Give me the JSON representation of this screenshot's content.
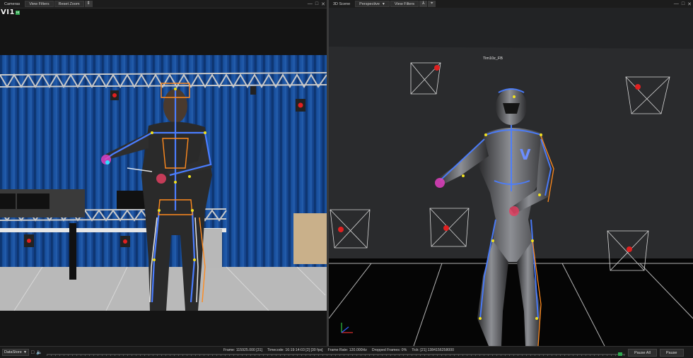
{
  "left_toolbar": {
    "cameras_label": "Cameras",
    "view_filters_label": "View Filters",
    "reset_zoom_label": "Reset Zoom",
    "extra_icon": "expand-icon"
  },
  "right_toolbar": {
    "scene_label": "3D Scene",
    "perspective_label": "Perspective",
    "view_filters_label": "View Filters",
    "icons": [
      "axis-icon",
      "camera-view-icon"
    ]
  },
  "window_controls": {
    "minimize": "—",
    "maximize": "□",
    "close": "✕"
  },
  "left_overlay": {
    "logo_text": "VI1",
    "logo_badge": "HI"
  },
  "right_overlay": {
    "subject_name": "Tim10z_FB"
  },
  "statusbar": {
    "data_store": "DataStore",
    "frame": "Frame: 115925.000 [31]",
    "timecode": "Timecode: 16:19:14:03 [2] [30 fps]",
    "frame_rate": "Frame Rate: 120.000Hz",
    "dropped_frames": "Dropped Frames: 0%",
    "tick": "Tick: [21] 1384156258000",
    "pause_all": "Pause All",
    "pause": "Pause"
  },
  "colors": {
    "accent_green": "#2fa84f",
    "skeleton_blue": "#4a7dff",
    "skeleton_orange": "#ff8a1e",
    "marker_yellow": "#f0e020"
  }
}
